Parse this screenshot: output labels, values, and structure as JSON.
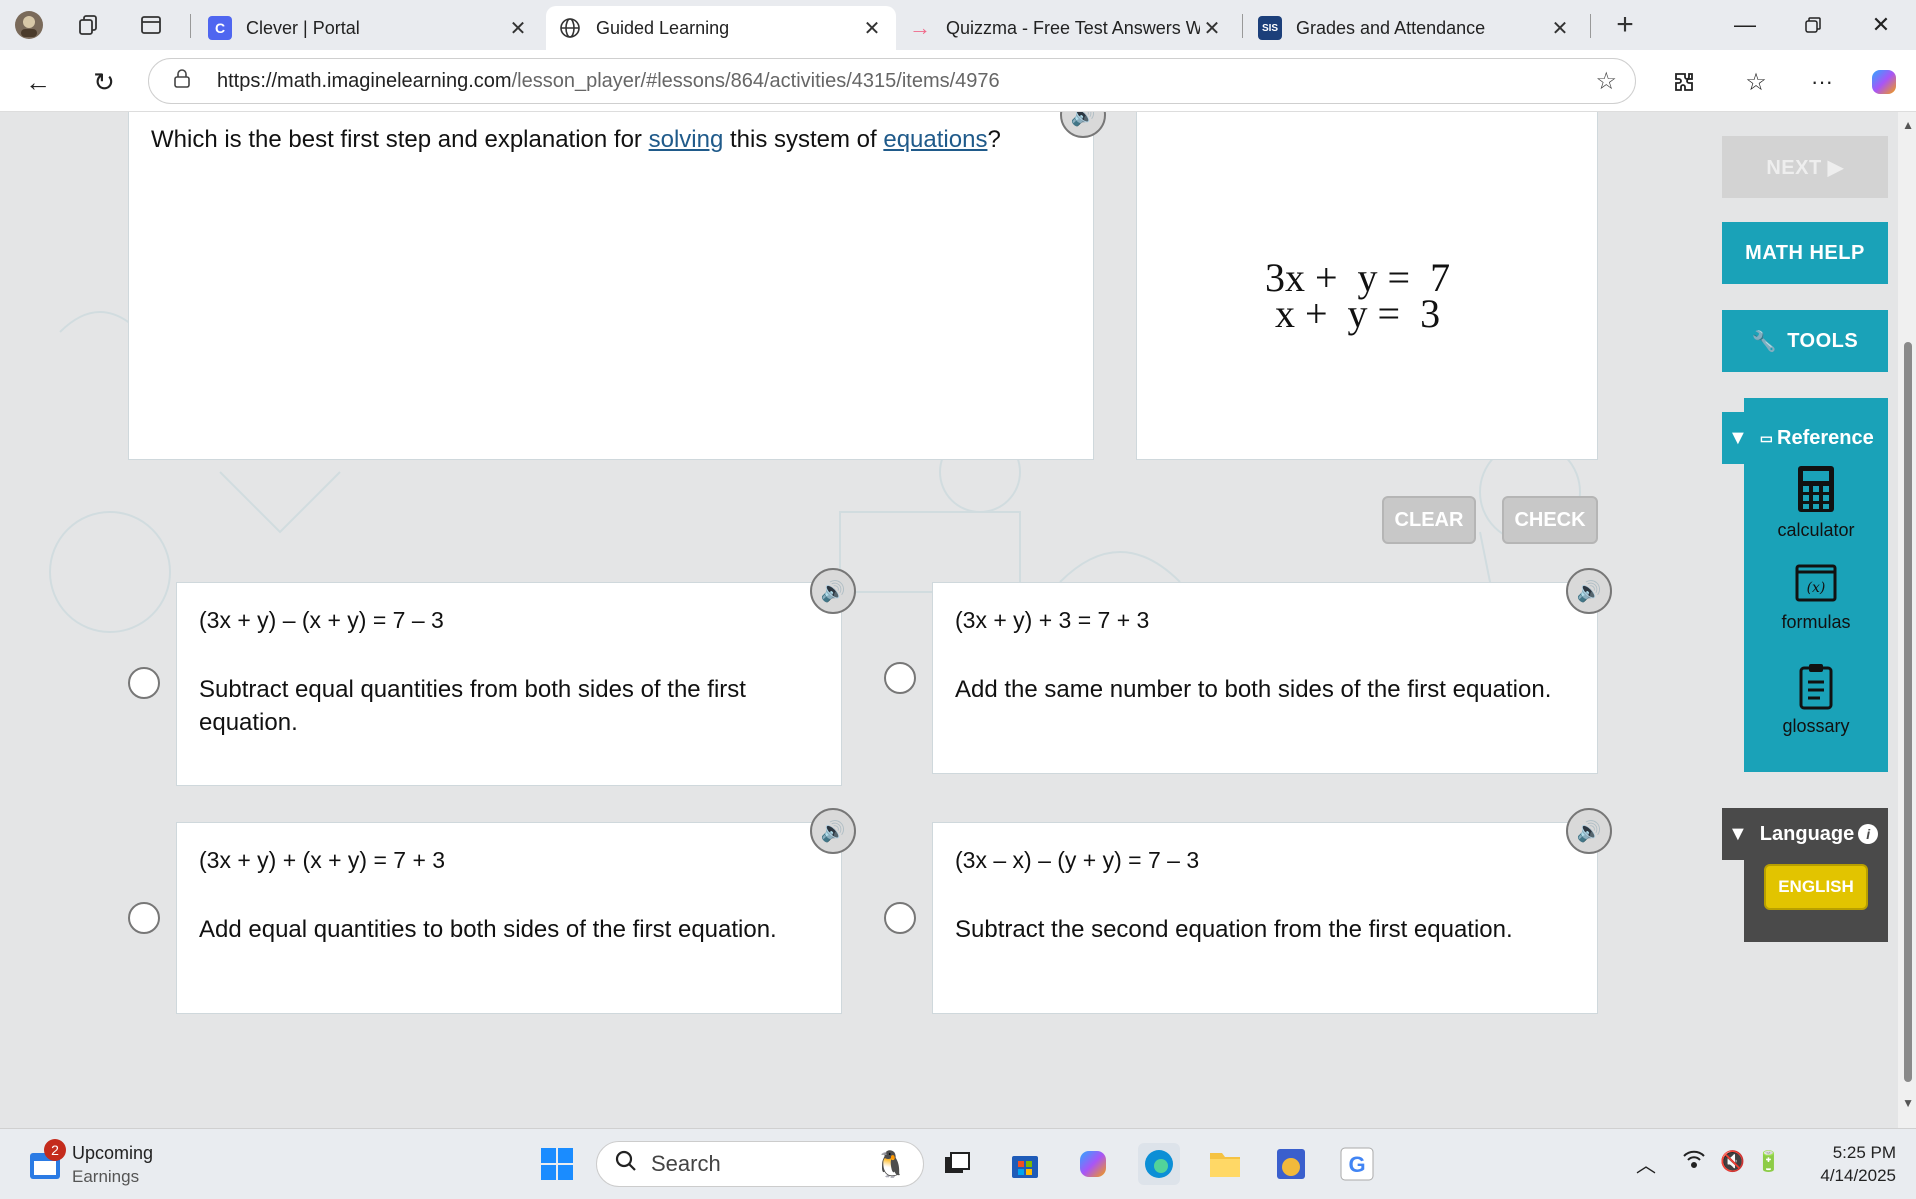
{
  "browser": {
    "tabs": [
      {
        "title": "Clever | Portal",
        "favicon": "C",
        "favicon_color": "#4f66f0"
      },
      {
        "title": "Guided Learning",
        "favicon": "globe-icon",
        "favicon_color": "#333333"
      },
      {
        "title": "Quizzma - Free Test Answers We",
        "favicon": "arrow-icon",
        "favicon_color": "#f06a8a"
      },
      {
        "title": "Grades and Attendance",
        "favicon": "SIS",
        "favicon_color": "#1c3f7a"
      }
    ],
    "url_host": "https://math.imaginelearning.com",
    "url_path": "/lesson_player/#lessons/864/activities/4315/items/4976"
  },
  "lesson": {
    "question_prefix": "Which is the best first step and explanation for ",
    "question_link1": "solving",
    "question_middle": " this system of ",
    "question_link2": "equations",
    "question_suffix": "?",
    "equation1": "3x +  y =  7",
    "equation2": " x +  y =  3",
    "clear_label": "CLEAR",
    "check_label": "CHECK",
    "choices": [
      {
        "equation": "(3x + y) – (x + y) = 7 – 3",
        "explanation": "Subtract equal quantities from both sides of the first equation."
      },
      {
        "equation": "(3x + y) + 3 = 7 + 3",
        "explanation": "Add the same number to both sides of the first equation."
      },
      {
        "equation": "(3x + y) + (x + y) = 7 + 3",
        "explanation": "Add equal quantities to both sides of the first equation."
      },
      {
        "equation": "(3x – x) – (y + y) = 7 – 3",
        "explanation": "Subtract the second equation from the first equation."
      }
    ]
  },
  "sidebar": {
    "next_label": "NEXT ▶",
    "math_help_label": "MATH HELP",
    "tools_label": "TOOLS",
    "reference_label": "Reference",
    "reference_items": [
      "calculator",
      "formulas",
      "glossary"
    ],
    "language_label": "Language",
    "english_label": "ENGLISH"
  },
  "taskbar": {
    "notification_badge": "2",
    "widget_title": "Upcoming",
    "widget_subtitle": "Earnings",
    "search_placeholder": "Search",
    "time": "5:25 PM",
    "date": "4/14/2025"
  },
  "colors": {
    "accent_teal": "#1aa2b8",
    "english_yellow": "#e2c400"
  }
}
